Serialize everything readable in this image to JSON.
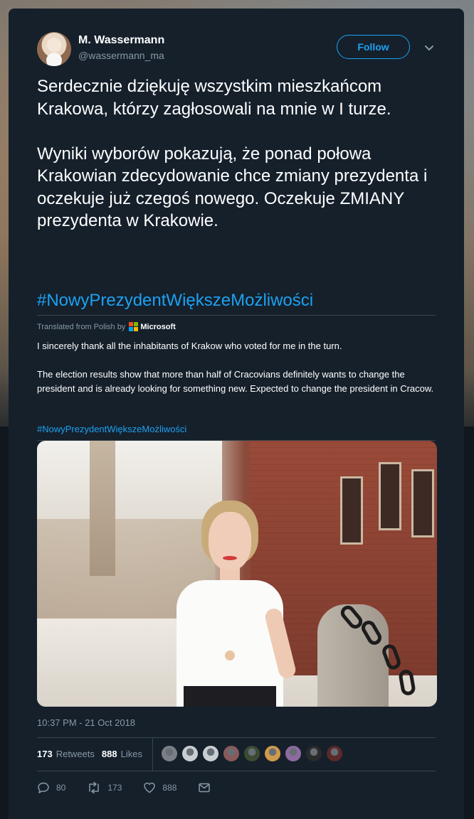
{
  "author": {
    "display_name": "M. Wassermann",
    "handle": "@wassermann_ma",
    "follow_label": "Follow"
  },
  "tweet": {
    "text": "Serdecznie dziękuję wszystkim mieszkańcom Krakowa, którzy zagłosowali na mnie w I turze.\n\nWyniki wyborów pokazują, że ponad połowa Krakowian zdecydowanie chce zmiany prezydenta i oczekuje już czegoś nowego. Oczekuje ZMIANY prezydenta w Krakowie.",
    "hashtag": "#NowyPrezydentWiększeMożliwości"
  },
  "translation": {
    "label": "Translated from Polish by",
    "provider": "Microsoft",
    "text": "I sincerely thank all the inhabitants of Krakow who voted for me in the turn.\n\nThe election results show that more than half of Cracovians definitely wants to change the president and is already looking for something new. Expected to change the president in Cracow.",
    "hashtag": "#NowyPrezydentWiększeMożliwości"
  },
  "timestamp": "10:37 PM - 21 Oct 2018",
  "stats": {
    "retweets_count": "173",
    "retweets_label": "Retweets",
    "likes_count": "888",
    "likes_label": "Likes"
  },
  "actions": {
    "replies": "80",
    "retweets": "173",
    "likes": "888"
  },
  "colors": {
    "background": "#15202b",
    "accent": "#1da1f2",
    "muted": "#8899a6"
  },
  "liker_avatars": [
    "#7b7f86",
    "#c9ced3",
    "#c9ced3",
    "#8a5a5a",
    "#3d4a33",
    "#d09a4a",
    "#8e6aa0",
    "#2b2b2b",
    "#5a2a2a"
  ]
}
